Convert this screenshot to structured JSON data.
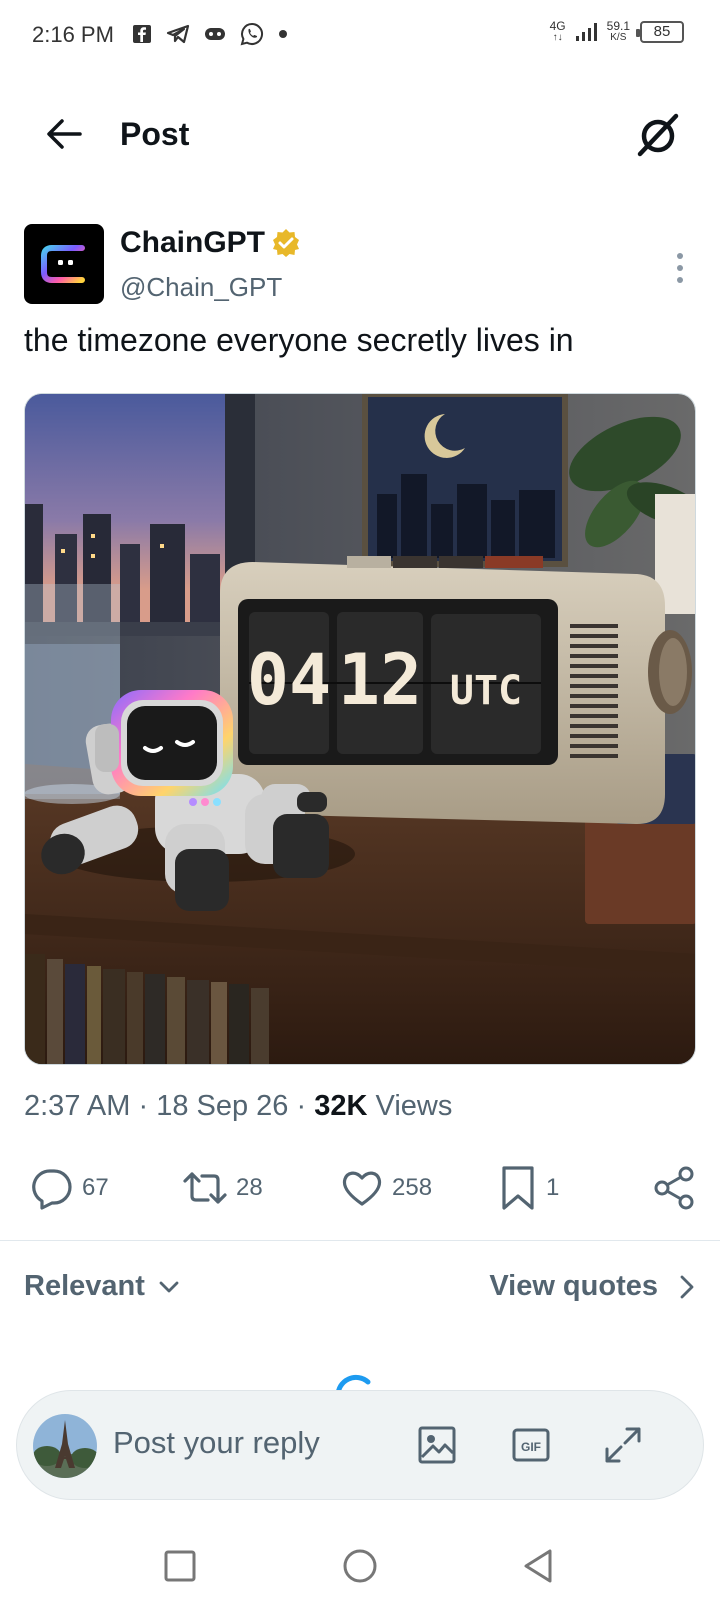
{
  "status_bar": {
    "time": "2:16 PM",
    "notification_icons": [
      "facebook-icon",
      "telegram-icon",
      "game-controller-icon",
      "whatsapp-icon",
      "dot-icon"
    ],
    "network_type": "4G",
    "speed_value": "59.1",
    "speed_unit": "K/S",
    "battery": "85"
  },
  "header": {
    "title": "Post",
    "back_icon": "arrow-left-icon",
    "grok_icon": "grok-icon"
  },
  "post": {
    "author_name": "ChainGPT",
    "author_handle": "@Chain_GPT",
    "verified_color": "#e8b829",
    "text": "the timezone everyone secretly lives in",
    "image": {
      "clock_digits_1": "04",
      "clock_digits_2": "12",
      "clock_label": "UTC"
    },
    "time": "2:37 AM",
    "separator": "·",
    "date": "18 Sep 26",
    "views_count": "32K",
    "views_label": "Views"
  },
  "actions": {
    "replies": "67",
    "reposts": "28",
    "likes": "258",
    "bookmarks": "1"
  },
  "sort": {
    "relevant_label": "Relevant",
    "view_quotes_label": "View quotes"
  },
  "reply_bar": {
    "placeholder": "Post your reply",
    "gif_label": "GIF"
  },
  "colors": {
    "accent": "#1d9bf0",
    "text_secondary": "#536471",
    "text_primary": "#0f1419"
  }
}
